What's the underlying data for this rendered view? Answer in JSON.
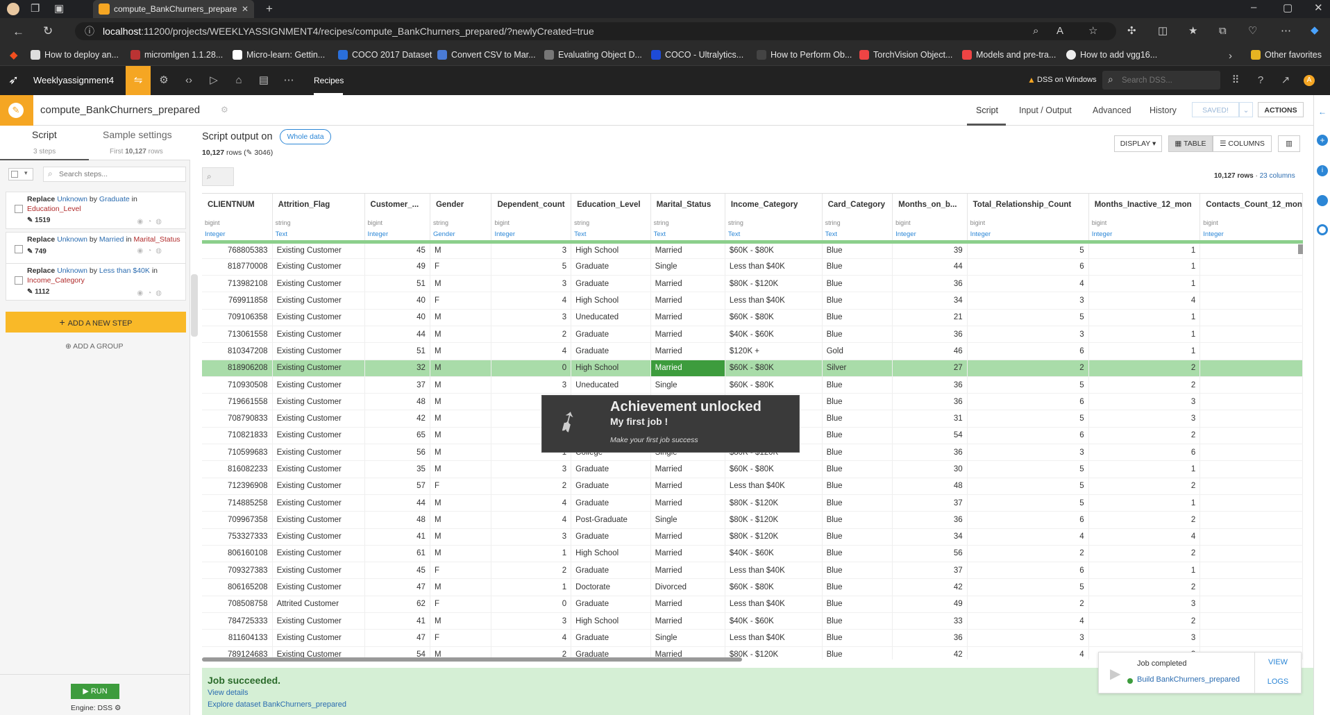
{
  "browser": {
    "tab_title": "compute_BankChurners_prepare",
    "url_host": "localhost",
    "url_rest": ":11200/projects/WEEKLYASSIGNMENT4/recipes/compute_BankChurners_prepared/?newlyCreated=true",
    "bookmarks": [
      "How to deploy an...",
      "micromlgen 1.1.28...",
      "Micro-learn: Gettin...",
      "COCO 2017 Dataset",
      "Convert CSV to Mar...",
      "Evaluating Object D...",
      "COCO - Ultralytics...",
      "How to Perform Ob...",
      "TorchVision Object...",
      "Models and pre-tra...",
      "How to add vgg16..."
    ],
    "other_favorites": "Other favorites"
  },
  "dss": {
    "project": "Weeklyassignment4",
    "nav_recipes": "Recipes",
    "dss_on": "DSS on Windows",
    "search_placeholder": "Search DSS...",
    "avatar": "A"
  },
  "recipe": {
    "name": "compute_BankChurners_prepared",
    "tabs": [
      "Script",
      "Input / Output",
      "Advanced",
      "History"
    ],
    "saved": "SAVED!",
    "actions": "ACTIONS"
  },
  "left": {
    "tab_script": "Script",
    "tab_sample": "Sample settings",
    "steps_count": "3 steps",
    "first_rows_label": "First",
    "first_rows_value": "10,127",
    "first_rows_suffix": "rows",
    "search_placeholder": "Search steps...",
    "steps": [
      {
        "w1": "Replace",
        "v1": "Unknown",
        "w2": "by",
        "v2": "Graduate",
        "w3": "in",
        "col": "Education_Level",
        "count": "1519"
      },
      {
        "w1": "Replace",
        "v1": "Unknown",
        "w2": "by",
        "v2": "Married",
        "w3": "in",
        "col": "Marital_Status",
        "count": "749"
      },
      {
        "w1": "Replace",
        "v1": "Unknown",
        "w2": "by",
        "v2": "Less than $40K",
        "w3": "in",
        "col": "Income_Category",
        "count": "1112"
      }
    ],
    "add_step": "ADD A NEW STEP",
    "add_group": "ADD A GROUP",
    "run": "RUN",
    "engine": "Engine: DSS"
  },
  "output": {
    "title": "Script output on",
    "whole_data": "Whole data",
    "rows": "10,127",
    "rows_label": "rows (",
    "modified": "3046",
    "close_paren": ")",
    "display": "DISPLAY",
    "table": "TABLE",
    "columns": "COLUMNS",
    "rows_right": "10,127 rows",
    "cols_right": "23 columns"
  },
  "table": {
    "headers": [
      "CLIENTNUM",
      "Attrition_Flag",
      "Customer_...",
      "Gender",
      "Dependent_count",
      "Education_Level",
      "Marital_Status",
      "Income_Category",
      "Card_Category",
      "Months_on_b...",
      "Total_Relationship_Count",
      "Months_Inactive_12_mon",
      "Contacts_Count_12_mon"
    ],
    "storage": [
      "bigint",
      "string",
      "bigint",
      "string",
      "bigint",
      "string",
      "string",
      "string",
      "string",
      "bigint",
      "bigint",
      "bigint",
      "bigint"
    ],
    "meanings": [
      "Integer",
      "Text",
      "Integer",
      "Gender",
      "Integer",
      "Text",
      "Text",
      "Text",
      "Text",
      "Integer",
      "Integer",
      "Integer",
      "Integer"
    ],
    "rows": [
      [
        "768805383",
        "Existing Customer",
        "45",
        "M",
        "3",
        "High School",
        "Married",
        "$60K - $80K",
        "Blue",
        "39",
        "5",
        "1",
        ""
      ],
      [
        "818770008",
        "Existing Customer",
        "49",
        "F",
        "5",
        "Graduate",
        "Single",
        "Less than $40K",
        "Blue",
        "44",
        "6",
        "1",
        ""
      ],
      [
        "713982108",
        "Existing Customer",
        "51",
        "M",
        "3",
        "Graduate",
        "Married",
        "$80K - $120K",
        "Blue",
        "36",
        "4",
        "1",
        ""
      ],
      [
        "769911858",
        "Existing Customer",
        "40",
        "F",
        "4",
        "High School",
        "Married",
        "Less than $40K",
        "Blue",
        "34",
        "3",
        "4",
        ""
      ],
      [
        "709106358",
        "Existing Customer",
        "40",
        "M",
        "3",
        "Uneducated",
        "Married",
        "$60K - $80K",
        "Blue",
        "21",
        "5",
        "1",
        ""
      ],
      [
        "713061558",
        "Existing Customer",
        "44",
        "M",
        "2",
        "Graduate",
        "Married",
        "$40K - $60K",
        "Blue",
        "36",
        "3",
        "1",
        ""
      ],
      [
        "810347208",
        "Existing Customer",
        "51",
        "M",
        "4",
        "Graduate",
        "Married",
        "$120K +",
        "Gold",
        "46",
        "6",
        "1",
        ""
      ],
      [
        "818906208",
        "Existing Customer",
        "32",
        "M",
        "0",
        "High School",
        "Married",
        "$60K - $80K",
        "Silver",
        "27",
        "2",
        "2",
        ""
      ],
      [
        "710930508",
        "Existing Customer",
        "37",
        "M",
        "3",
        "Uneducated",
        "Single",
        "$60K - $80K",
        "Blue",
        "36",
        "5",
        "2",
        ""
      ],
      [
        "719661558",
        "Existing Customer",
        "48",
        "M",
        "",
        "",
        "",
        "",
        "Blue",
        "36",
        "6",
        "3",
        ""
      ],
      [
        "708790833",
        "Existing Customer",
        "42",
        "M",
        "",
        "",
        "",
        "",
        "Blue",
        "31",
        "5",
        "3",
        ""
      ],
      [
        "710821833",
        "Existing Customer",
        "65",
        "M",
        "",
        "",
        "",
        "",
        "Blue",
        "54",
        "6",
        "2",
        ""
      ],
      [
        "710599683",
        "Existing Customer",
        "56",
        "M",
        "1",
        "College",
        "Single",
        "$80K - $120K",
        "Blue",
        "36",
        "3",
        "6",
        ""
      ],
      [
        "816082233",
        "Existing Customer",
        "35",
        "M",
        "3",
        "Graduate",
        "Married",
        "$60K - $80K",
        "Blue",
        "30",
        "5",
        "1",
        ""
      ],
      [
        "712396908",
        "Existing Customer",
        "57",
        "F",
        "2",
        "Graduate",
        "Married",
        "Less than $40K",
        "Blue",
        "48",
        "5",
        "2",
        ""
      ],
      [
        "714885258",
        "Existing Customer",
        "44",
        "M",
        "4",
        "Graduate",
        "Married",
        "$80K - $120K",
        "Blue",
        "37",
        "5",
        "1",
        ""
      ],
      [
        "709967358",
        "Existing Customer",
        "48",
        "M",
        "4",
        "Post-Graduate",
        "Single",
        "$80K - $120K",
        "Blue",
        "36",
        "6",
        "2",
        ""
      ],
      [
        "753327333",
        "Existing Customer",
        "41",
        "M",
        "3",
        "Graduate",
        "Married",
        "$80K - $120K",
        "Blue",
        "34",
        "4",
        "4",
        ""
      ],
      [
        "806160108",
        "Existing Customer",
        "61",
        "M",
        "1",
        "High School",
        "Married",
        "$40K - $60K",
        "Blue",
        "56",
        "2",
        "2",
        ""
      ],
      [
        "709327383",
        "Existing Customer",
        "45",
        "F",
        "2",
        "Graduate",
        "Married",
        "Less than $40K",
        "Blue",
        "37",
        "6",
        "1",
        ""
      ],
      [
        "806165208",
        "Existing Customer",
        "47",
        "M",
        "1",
        "Doctorate",
        "Divorced",
        "$60K - $80K",
        "Blue",
        "42",
        "5",
        "2",
        ""
      ],
      [
        "708508758",
        "Attrited Customer",
        "62",
        "F",
        "0",
        "Graduate",
        "Married",
        "Less than $40K",
        "Blue",
        "49",
        "2",
        "3",
        ""
      ],
      [
        "784725333",
        "Existing Customer",
        "41",
        "M",
        "3",
        "High School",
        "Married",
        "$40K - $60K",
        "Blue",
        "33",
        "4",
        "2",
        ""
      ],
      [
        "811604133",
        "Existing Customer",
        "47",
        "F",
        "4",
        "Graduate",
        "Single",
        "Less than $40K",
        "Blue",
        "36",
        "3",
        "3",
        ""
      ],
      [
        "789124683",
        "Existing Customer",
        "54",
        "M",
        "2",
        "Graduate",
        "Married",
        "$80K - $120K",
        "Blue",
        "42",
        "4",
        "3",
        ""
      ]
    ],
    "highlight_row": 7
  },
  "toast": {
    "title": "Achievement unlocked",
    "subtitle": "My first job !",
    "desc": "Make your first job success"
  },
  "job": {
    "status": "Job completed",
    "link": "Build BankChurners_prepared",
    "view": "VIEW",
    "logs": "LOGS"
  },
  "success": {
    "title": "Job succeeded.",
    "details": "View details",
    "explore": "Explore dataset BankChurners_prepared"
  },
  "colors": {
    "accent": "#f9a825",
    "dss_orange": "#f5a623",
    "success_green": "#3d9c3d",
    "link_blue": "#2b86d6"
  }
}
